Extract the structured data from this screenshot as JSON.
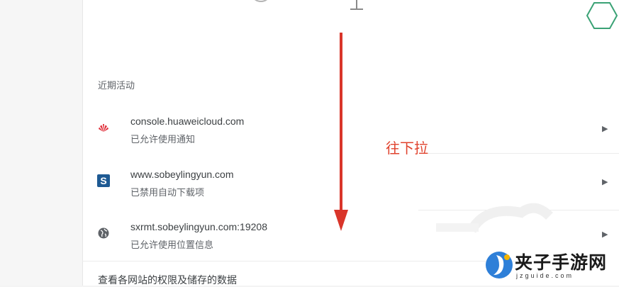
{
  "section": {
    "title": "近期活动"
  },
  "activity": [
    {
      "site": "console.huaweicloud.com",
      "status": "已允许使用通知",
      "icon": "huawei-logo-icon"
    },
    {
      "site": "www.sobeylingyun.com",
      "status": "已禁用自动下载项",
      "icon": "sobey-s-logo-icon"
    },
    {
      "site": "sxrmt.sobeylingyun.com:19208",
      "status": "已允许使用位置信息",
      "icon": "globe-icon"
    }
  ],
  "footer": {
    "link_label": "查看各网站的权限及储存的数据"
  },
  "annotation": {
    "text": "往下拉",
    "color": "#e0432e"
  },
  "watermark": {
    "text": "夹子手游网",
    "subtext": "jzguide.com",
    "logo_color": "#2e7fd8"
  },
  "colors": {
    "arrow": "#d9352a",
    "hexagon": "#3aa275"
  }
}
